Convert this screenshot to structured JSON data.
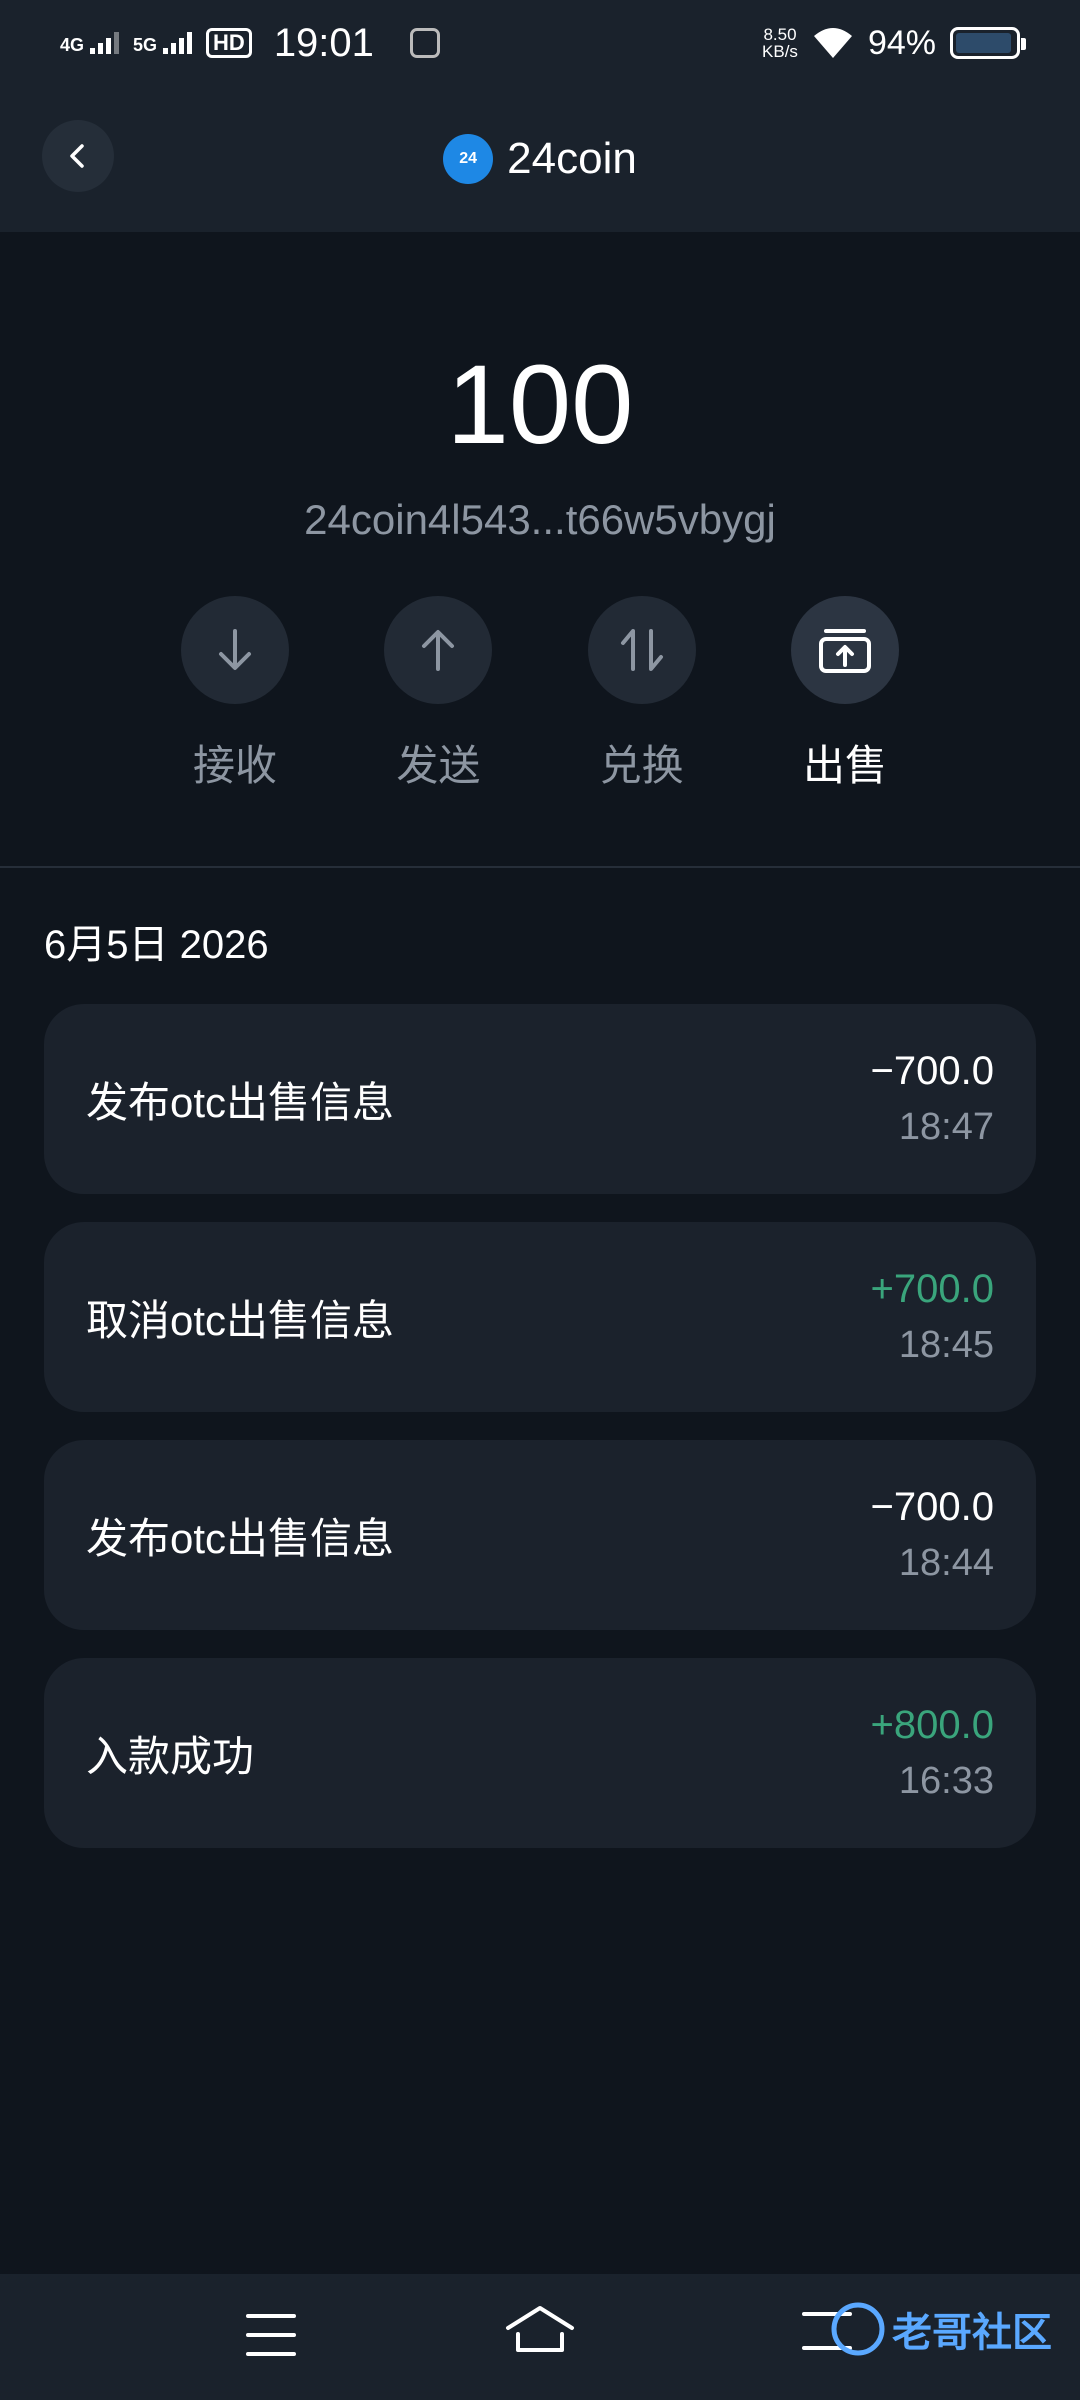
{
  "status_bar": {
    "net1": "4G",
    "net2": "5G",
    "hd_label": "HD",
    "time": "19:01",
    "speed_value": "8.50",
    "speed_unit": "KB/s",
    "battery": "94%"
  },
  "header": {
    "title": "24coin",
    "logo_text": "24"
  },
  "balance": "100",
  "address": "24coin4l543...t66w5vbygj",
  "actions": [
    {
      "label": "接收",
      "icon": "arrow-down-icon"
    },
    {
      "label": "发送",
      "icon": "arrow-up-icon"
    },
    {
      "label": "兑换",
      "icon": "swap-icon"
    },
    {
      "label": "出售",
      "icon": "sell-box-icon"
    }
  ],
  "date_label": "6月5日 2026",
  "transactions": [
    {
      "title": "发布otc出售信息",
      "amount": "−700.0",
      "time": "18:47"
    },
    {
      "title": "取消otc出售信息",
      "amount": "+700.0",
      "time": "18:45"
    },
    {
      "title": "发布otc出售信息",
      "amount": "−700.0",
      "time": "18:44"
    },
    {
      "title": "入款成功",
      "amount": "+800.0",
      "time": "16:33"
    }
  ],
  "colors": {
    "background": "#0f151d",
    "surface": "#1b222c",
    "positive": "#3aa57c",
    "muted": "#8d96a2",
    "brand": "#1e88e5"
  },
  "watermark": {
    "text": "老哥社区"
  }
}
